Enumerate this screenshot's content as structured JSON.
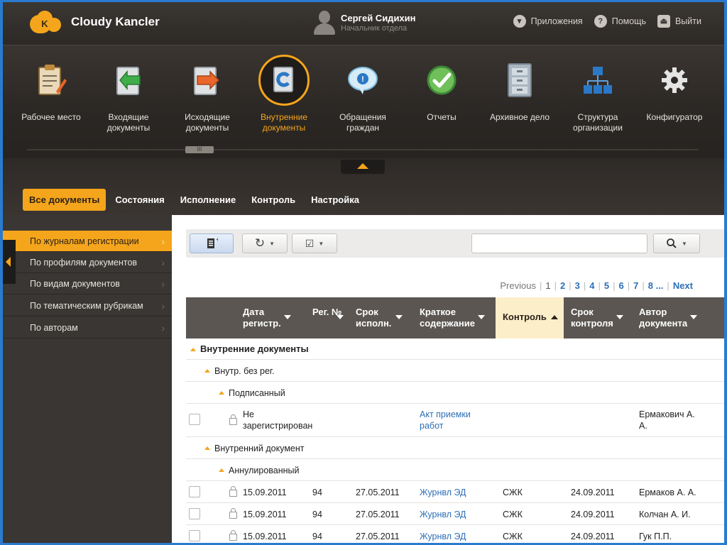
{
  "app": {
    "name": "Cloudy Kancler",
    "logo_letter": "K"
  },
  "user": {
    "name": "Сергей Сидихин",
    "role": "Начальник отдела"
  },
  "top_links": [
    {
      "label": "Приложения",
      "icon": "apps-icon"
    },
    {
      "label": "Помощь",
      "icon": "help-icon"
    },
    {
      "label": "Выйти",
      "icon": "exit-icon"
    }
  ],
  "modules": [
    {
      "label": "Рабочее место",
      "icon": "workplace-icon"
    },
    {
      "label": "Входящие документы",
      "icon": "incoming-docs-icon"
    },
    {
      "label": "Исходящие документы",
      "icon": "outgoing-docs-icon"
    },
    {
      "label": "Внутренние документы",
      "icon": "internal-docs-icon",
      "active": true
    },
    {
      "label": "Обращения граждан",
      "icon": "citizen-appeals-icon"
    },
    {
      "label": "Отчеты",
      "icon": "reports-icon"
    },
    {
      "label": "Архивное дело",
      "icon": "archive-icon"
    },
    {
      "label": "Структура организации",
      "icon": "org-structure-icon"
    },
    {
      "label": "Конфигуратор",
      "icon": "configurator-icon"
    }
  ],
  "module_handle": "III",
  "tabs": [
    "Все документы",
    "Состояния",
    "Исполнение",
    "Контроль",
    "Настройка"
  ],
  "sidebar": [
    "По журналам регистрации",
    "По профилям документов",
    "По видам документов",
    "По тематическим рубрикам",
    "По авторам"
  ],
  "pager": {
    "previous": "Previous",
    "pages": [
      "1",
      "2",
      "3",
      "4",
      "5",
      "6",
      "7",
      "8 ..."
    ],
    "next": "Next"
  },
  "columns": [
    "Дата регистр.",
    "Рег. №",
    "Срок исполн.",
    "Краткое содержание",
    "Контроль",
    "Срок контроля",
    "Автор документа"
  ],
  "groups": {
    "g1": "Внутренние документы",
    "g2": "Внутр. без рег.",
    "g3": "Подписанный",
    "g4": "Внутренний документ",
    "g5": "Аннулированный"
  },
  "rows": [
    {
      "date": "Не зарегистрирован",
      "num": "",
      "due": "",
      "summary": "Акт приемки работ",
      "control": "",
      "control_due": "",
      "author": "Ермакович А. А."
    },
    {
      "date": "15.09.2011",
      "num": "94",
      "due": "27.05.2011",
      "summary": "Журнвл ЭД",
      "control": "СЖК",
      "control_due": "24.09.2011",
      "author": "Ермаков А. А."
    },
    {
      "date": "15.09.2011",
      "num": "94",
      "due": "27.05.2011",
      "summary": "Журнвл ЭД",
      "control": "СЖК",
      "control_due": "24.09.2011",
      "author": "Колчан А. И."
    },
    {
      "date": "15.09.2011",
      "num": "94",
      "due": "27.05.2011",
      "summary": "Журнвл ЭД",
      "control": "СЖК",
      "control_due": "24.09.2011",
      "author": "Гук П.П."
    }
  ],
  "colors": {
    "accent": "#f5a51c",
    "link": "#2d6fb6",
    "header_bg": "#2c2926",
    "table_header": "#5b5651"
  }
}
